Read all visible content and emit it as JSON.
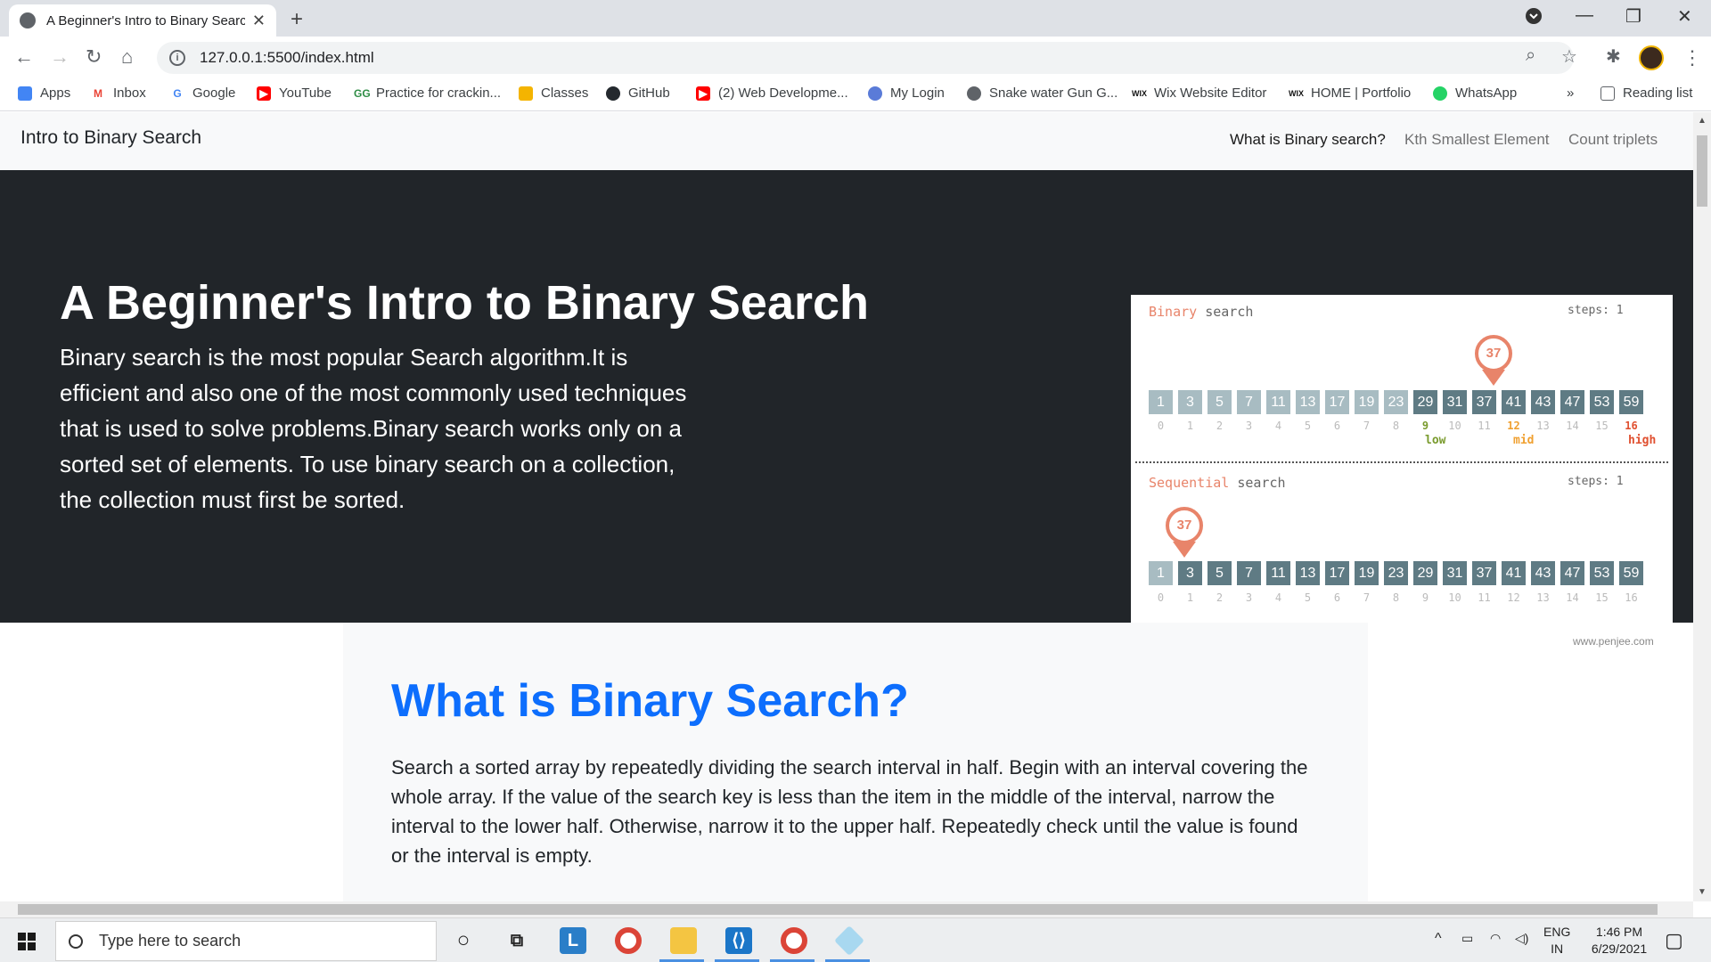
{
  "browser": {
    "tab_title": "A Beginner's Intro to Binary Search",
    "url": "127.0.0.1:5500/index.html",
    "bookmarks": [
      {
        "label": "Apps",
        "color": "#ea4335"
      },
      {
        "label": "Inbox",
        "color": "#ea4335"
      },
      {
        "label": "Google",
        "color": "#4285f4"
      },
      {
        "label": "YouTube",
        "color": "#ff0000"
      },
      {
        "label": "Practice for crackin...",
        "color": "#2f8d46"
      },
      {
        "label": "Classes",
        "color": "#f4b400"
      },
      {
        "label": "GitHub",
        "color": "#24292e"
      },
      {
        "label": "(2) Web Developme...",
        "color": "#ff0000"
      },
      {
        "label": "My Login",
        "color": "#5a7bd8"
      },
      {
        "label": "Snake water Gun G...",
        "color": "#5f6368"
      },
      {
        "label": "Wix Website Editor",
        "color": "#111111"
      },
      {
        "label": "HOME | Portfolio",
        "color": "#111111"
      },
      {
        "label": "WhatsApp",
        "color": "#25d366"
      }
    ],
    "reading_list": "Reading list",
    "more_bookmarks": "»"
  },
  "page": {
    "brand": "Intro to Binary Search",
    "nav": [
      "What is Binary search?",
      "Kth Smallest Element",
      "Count triplets"
    ],
    "hero_title": "A Beginner's Intro to Binary Search",
    "hero_text": "Binary search is the most popular Search algorithm.It is efficient and also one of the most commonly used techniques that is used to solve problems.Binary search works only on a sorted set of elements. To use binary search on a collection, the collection must first be sorted.",
    "section_title": "What is Binary Search?",
    "section_text": "Search a sorted array by repeatedly dividing the search interval in half. Begin with an interval covering the whole array. If the value of the search key is less than the item in the middle of the interval, narrow the interval to the lower half. Otherwise, narrow it to the upper half. Repeatedly check until the value is found or the interval is empty."
  },
  "illustration": {
    "binary_label_hl": "Binary",
    "binary_label_rest": " search",
    "sequential_label_hl": "Sequential",
    "sequential_label_rest": " search",
    "steps_text": "steps: 1",
    "target": "37",
    "array": [
      "1",
      "3",
      "5",
      "7",
      "11",
      "13",
      "17",
      "19",
      "23",
      "29",
      "31",
      "37",
      "41",
      "43",
      "47",
      "53",
      "59"
    ],
    "indices": [
      "0",
      "1",
      "2",
      "3",
      "4",
      "5",
      "6",
      "7",
      "8",
      "9",
      "10",
      "11",
      "12",
      "13",
      "14",
      "15",
      "16"
    ],
    "low_label": "low",
    "mid_label": "mid",
    "high_label": "high",
    "credit": "www.penjee.com",
    "colors": {
      "cell": "#5f7b84",
      "cell_dim": "#a8bcc2",
      "accent": "#e8846a"
    }
  },
  "taskbar": {
    "search_placeholder": "Type here to search",
    "lang": "ENG",
    "region": "IN",
    "time": "1:46 PM",
    "date": "6/29/2021"
  }
}
